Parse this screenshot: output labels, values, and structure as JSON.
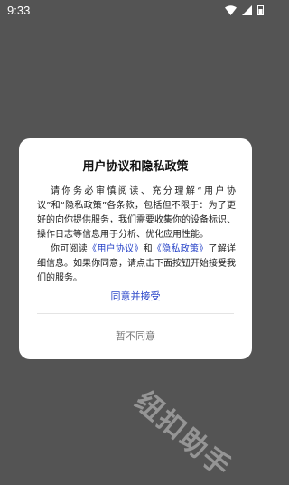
{
  "status_bar": {
    "time": "9:33",
    "icons": [
      "wifi-icon",
      "signal-icon",
      "battery-icon"
    ]
  },
  "dialog": {
    "title": "用户协议和隐私政策",
    "paragraph1": "请你务必审慎阅读、充分理解“用户协议”和“隐私政策”各条款，包括但不限于：为了更好的向你提供服务，我们需要收集你的设备标识、操作日志等信息用于分析、优化应用性能。",
    "paragraph2_prefix": "你可阅读",
    "user_agreement_link": "《用户协议》",
    "paragraph2_and": "和",
    "privacy_policy_link": "《隐私政策》",
    "paragraph2_suffix": "了解详细信息。如果你同意，请点击下面按钮开始接受我们的服务。",
    "agree_label": "同意并接受",
    "disagree_label": "暂不同意"
  },
  "watermark": "纽扣助手",
  "colors": {
    "background": "#545454",
    "accent": "#2a46c9"
  }
}
